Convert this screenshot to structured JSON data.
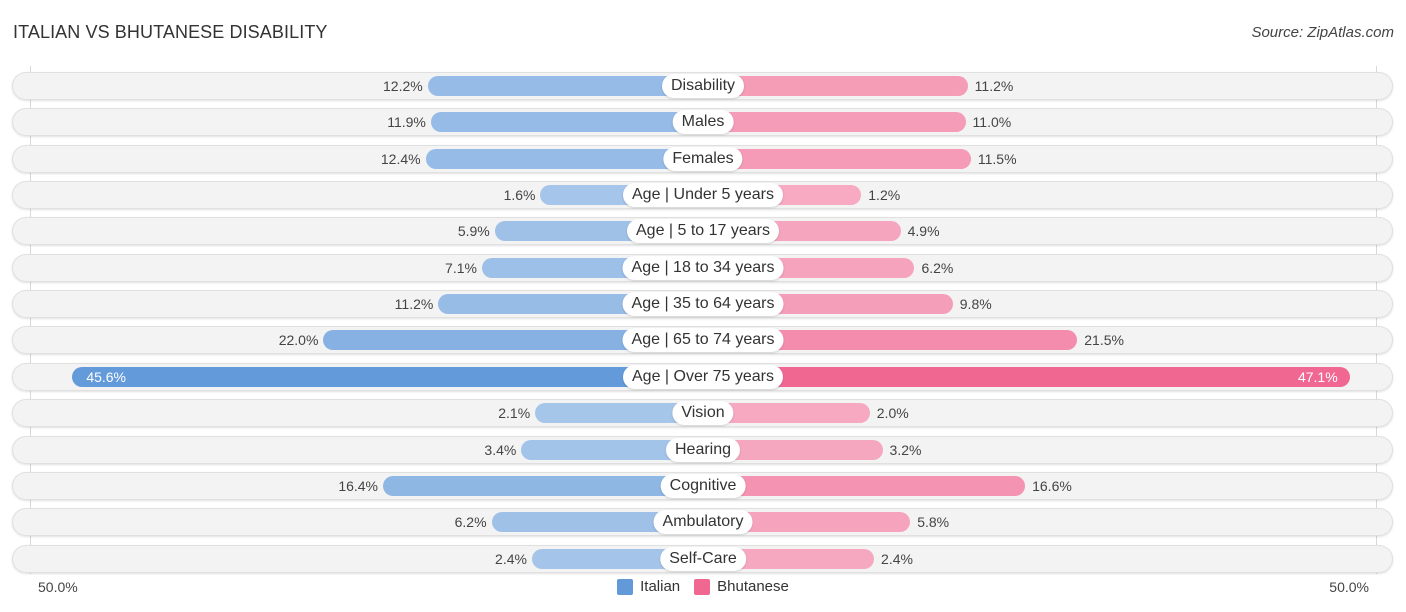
{
  "title": "ITALIAN VS BHUTANESE DISABILITY",
  "source": "Source: ZipAtlas.com",
  "chart_data": {
    "type": "bar",
    "orientation": "horizontal-diverging",
    "title": "ITALIAN VS BHUTANESE DISABILITY",
    "categories": [
      "Disability",
      "Males",
      "Females",
      "Age | Under 5 years",
      "Age | 5 to 17 years",
      "Age | 18 to 34 years",
      "Age | 35 to 64 years",
      "Age | 65 to 74 years",
      "Age | Over 75 years",
      "Vision",
      "Hearing",
      "Cognitive",
      "Ambulatory",
      "Self-Care"
    ],
    "series": [
      {
        "name": "Italian",
        "color": "#6199d9",
        "values": [
          12.2,
          11.9,
          12.4,
          1.6,
          5.9,
          7.1,
          11.2,
          22.0,
          45.6,
          2.1,
          3.4,
          16.4,
          6.2,
          2.4
        ],
        "labels": [
          "12.2%",
          "11.9%",
          "12.4%",
          "1.6%",
          "5.9%",
          "7.1%",
          "11.2%",
          "22.0%",
          "45.6%",
          "2.1%",
          "3.4%",
          "16.4%",
          "6.2%",
          "2.4%"
        ]
      },
      {
        "name": "Bhutanese",
        "color": "#f06892",
        "values": [
          11.2,
          11.0,
          11.5,
          1.2,
          4.9,
          6.2,
          9.8,
          21.5,
          47.1,
          2.0,
          3.2,
          16.6,
          5.8,
          2.4
        ],
        "labels": [
          "11.2%",
          "11.0%",
          "11.5%",
          "1.2%",
          "4.9%",
          "6.2%",
          "9.8%",
          "21.5%",
          "47.1%",
          "2.0%",
          "3.2%",
          "16.6%",
          "5.8%",
          "2.4%"
        ]
      }
    ],
    "xlim": [
      -50,
      50
    ],
    "axis_labels": {
      "left": "50.0%",
      "right": "50.0%"
    },
    "legend": {
      "placement": "bottom-center",
      "entries": [
        "Italian",
        "Bhutanese"
      ]
    }
  }
}
